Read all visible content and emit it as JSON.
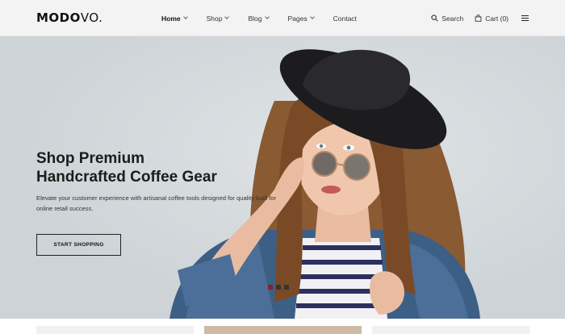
{
  "brand": {
    "logo_bold": "MODO",
    "logo_light": "VO."
  },
  "nav": {
    "items": [
      {
        "label": "Home",
        "has_dropdown": true,
        "active": true
      },
      {
        "label": "Shop",
        "has_dropdown": true,
        "active": false
      },
      {
        "label": "Blog",
        "has_dropdown": true,
        "active": false
      },
      {
        "label": "Pages",
        "has_dropdown": true,
        "active": false
      },
      {
        "label": "Contact",
        "has_dropdown": false,
        "active": false
      }
    ]
  },
  "tools": {
    "search_label": "Search",
    "cart_label": "Cart (0)",
    "search_icon": "search-icon",
    "cart_icon": "bag-icon",
    "menu_icon": "hamburger-icon"
  },
  "hero": {
    "headline_line1": "Shop Premium",
    "headline_line2": "Handcrafted Coffee Gear",
    "subtext": "Elevate your customer experience with artisanal coffee tools designed for quality built for online retail success.",
    "cta_label": "START SHOPPING",
    "slide_count": 3,
    "active_slide": 1
  },
  "colors": {
    "accent": "#8b1e1e",
    "hero_bg": "#d3d8db",
    "header_bg": "#f3f3f3"
  }
}
